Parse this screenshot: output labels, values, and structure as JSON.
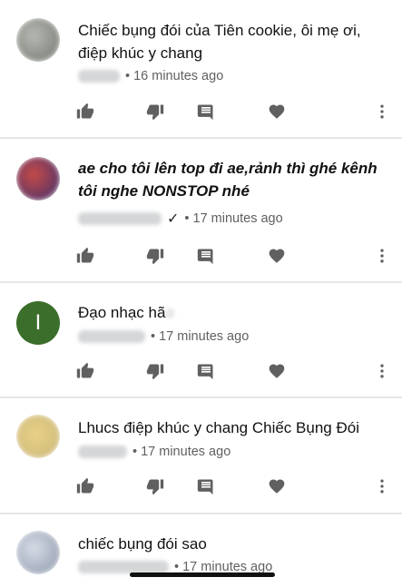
{
  "comments": [
    {
      "text": "Chiếc bụng đói của Tiên cookie, ôi mẹ ơi, điệp khúc y chang",
      "time": "• 16 minutes ago",
      "avatar_color": "#8a8f84"
    },
    {
      "text": "ae cho tôi lên top đi ae,rảnh thì ghé kênh tôi nghe NONSTOP nhé",
      "time": "• 17 minutes ago",
      "verified": "✓",
      "avatar_color": "#9c3a3a"
    },
    {
      "text": "Đạo nhạc hã",
      "time": "• 17 minutes ago",
      "avatar_letter": "I",
      "avatar_color": "#3a6e2a"
    },
    {
      "text": "Lhucs điệp khúc y chang Chiếc Bụng Đói",
      "time": "• 17 minutes ago",
      "avatar_color": "#d9c27a"
    },
    {
      "text": "chiếc bụng đói sao",
      "time": "• 17 minutes ago",
      "avatar_color": "#a9b4c4"
    }
  ],
  "icons": {
    "like": "thumb-up-icon",
    "dislike": "thumb-down-icon",
    "reply": "comment-icon",
    "heart": "heart-icon",
    "more": "more-vert-icon"
  }
}
